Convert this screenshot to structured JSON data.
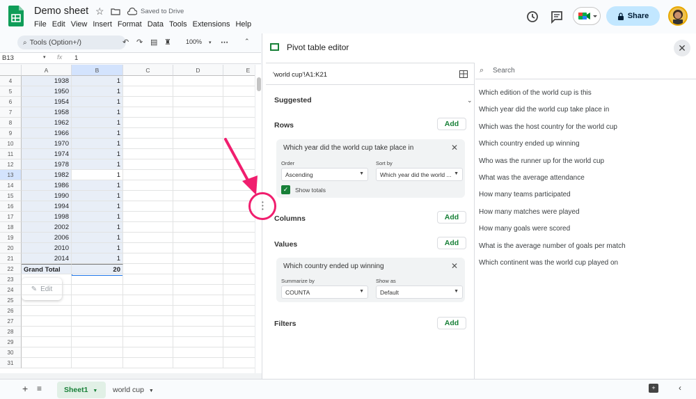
{
  "header": {
    "doc_title": "Demo sheet",
    "saved_status": "Saved to Drive",
    "menu": [
      "File",
      "Edit",
      "View",
      "Insert",
      "Format",
      "Data",
      "Tools",
      "Extensions",
      "Help"
    ],
    "share_label": "Share"
  },
  "toolbar": {
    "search_placeholder": "Tools (Option+/)",
    "zoom": "100%"
  },
  "formula_bar": {
    "name_box": "B13",
    "fx": "fx",
    "value": "1"
  },
  "grid": {
    "columns": [
      "A",
      "B",
      "C",
      "D",
      "E"
    ],
    "rows": [
      {
        "n": "4",
        "a": "1938",
        "b": "1"
      },
      {
        "n": "5",
        "a": "1950",
        "b": "1"
      },
      {
        "n": "6",
        "a": "1954",
        "b": "1"
      },
      {
        "n": "7",
        "a": "1958",
        "b": "1"
      },
      {
        "n": "8",
        "a": "1962",
        "b": "1"
      },
      {
        "n": "9",
        "a": "1966",
        "b": "1"
      },
      {
        "n": "10",
        "a": "1970",
        "b": "1"
      },
      {
        "n": "11",
        "a": "1974",
        "b": "1"
      },
      {
        "n": "12",
        "a": "1978",
        "b": "1"
      },
      {
        "n": "13",
        "a": "1982",
        "b": "1"
      },
      {
        "n": "14",
        "a": "1986",
        "b": "1"
      },
      {
        "n": "15",
        "a": "1990",
        "b": "1"
      },
      {
        "n": "16",
        "a": "1994",
        "b": "1"
      },
      {
        "n": "17",
        "a": "1998",
        "b": "1"
      },
      {
        "n": "18",
        "a": "2002",
        "b": "1"
      },
      {
        "n": "19",
        "a": "2006",
        "b": "1"
      },
      {
        "n": "20",
        "a": "2010",
        "b": "1"
      },
      {
        "n": "21",
        "a": "2014",
        "b": "1"
      },
      {
        "n": "22",
        "a": "Grand Total",
        "b": "20"
      },
      {
        "n": "23",
        "a": "",
        "b": ""
      },
      {
        "n": "24",
        "a": "",
        "b": ""
      },
      {
        "n": "25",
        "a": "",
        "b": ""
      },
      {
        "n": "26",
        "a": "",
        "b": ""
      },
      {
        "n": "27",
        "a": "",
        "b": ""
      },
      {
        "n": "28",
        "a": "",
        "b": ""
      },
      {
        "n": "29",
        "a": "",
        "b": ""
      },
      {
        "n": "30",
        "a": "",
        "b": ""
      },
      {
        "n": "31",
        "a": "",
        "b": ""
      }
    ],
    "edit_popup": "Edit"
  },
  "pivot": {
    "title": "Pivot table editor",
    "range": "'world cup'!A1:K21",
    "suggested": "Suggested",
    "rows_label": "Rows",
    "columns_label": "Columns",
    "values_label": "Values",
    "filters_label": "Filters",
    "add_label": "Add",
    "row_card": {
      "title": "Which year did the world cup take place in",
      "order_label": "Order",
      "order_value": "Ascending",
      "sortby_label": "Sort by",
      "sortby_value": "Which year did the world ...",
      "show_totals": "Show totals"
    },
    "value_card": {
      "title": "Which country ended up winning",
      "summarize_label": "Summarize by",
      "summarize_value": "COUNTA",
      "showas_label": "Show as",
      "showas_value": "Default"
    },
    "search_placeholder": "Search",
    "questions": [
      "Which edition of the world cup is this",
      "Which year did the world cup take place in",
      "Which was the host country for the world cup",
      "Which country ended up winning",
      "Who was the runner up for the world cup",
      "What was the average attendance",
      "How many teams participated",
      "How many matches were played",
      "How many goals were scored",
      "What is the average number of goals per match",
      "Which continent was the world cup played on"
    ]
  },
  "sheets": {
    "tabs": [
      "Sheet1",
      "world cup"
    ],
    "active": "Sheet1"
  },
  "colors": {
    "accent_green": "#188038",
    "share_bg": "#c2e7ff",
    "selection_blue": "#1a73e8",
    "annotation_pink": "#f01e6e"
  }
}
